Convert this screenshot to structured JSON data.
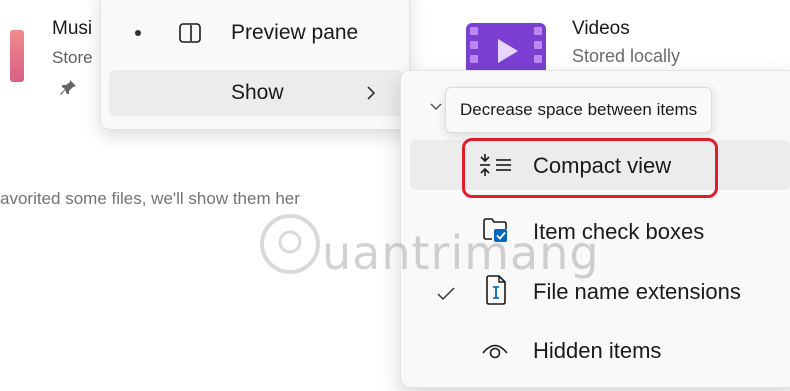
{
  "background": {
    "music_tile": {
      "name": "Musi",
      "subtitle": "Store"
    },
    "videos_tile": {
      "name": "Videos",
      "subtitle": "Stored locally"
    },
    "empty_message": "avorited some files, we'll show them her"
  },
  "parent_menu": {
    "items": [
      {
        "label": "Preview pane",
        "icon": "preview-pane-icon",
        "selected": true
      },
      {
        "label": "Show",
        "icon": "chevron-right-icon",
        "hovered": true
      }
    ]
  },
  "show_submenu": {
    "tooltip": "Decrease space between items",
    "items": [
      {
        "label": "Compact view",
        "icon": "compact-view-icon",
        "checked": false,
        "highlighted": true
      },
      {
        "label": "Item check boxes",
        "icon": "item-checkboxes-icon",
        "checked": false
      },
      {
        "label": "File name extensions",
        "icon": "file-extension-icon",
        "checked": true
      },
      {
        "label": "Hidden items",
        "icon": "eye-icon",
        "checked": false
      }
    ]
  },
  "watermark": {
    "text": "uantrimang"
  },
  "colors": {
    "accent_blue": "#0067c0",
    "highlight_red": "#e11d2a",
    "menu_bg": "#f9f9f9",
    "videos_purple": "#8b3fd6"
  }
}
